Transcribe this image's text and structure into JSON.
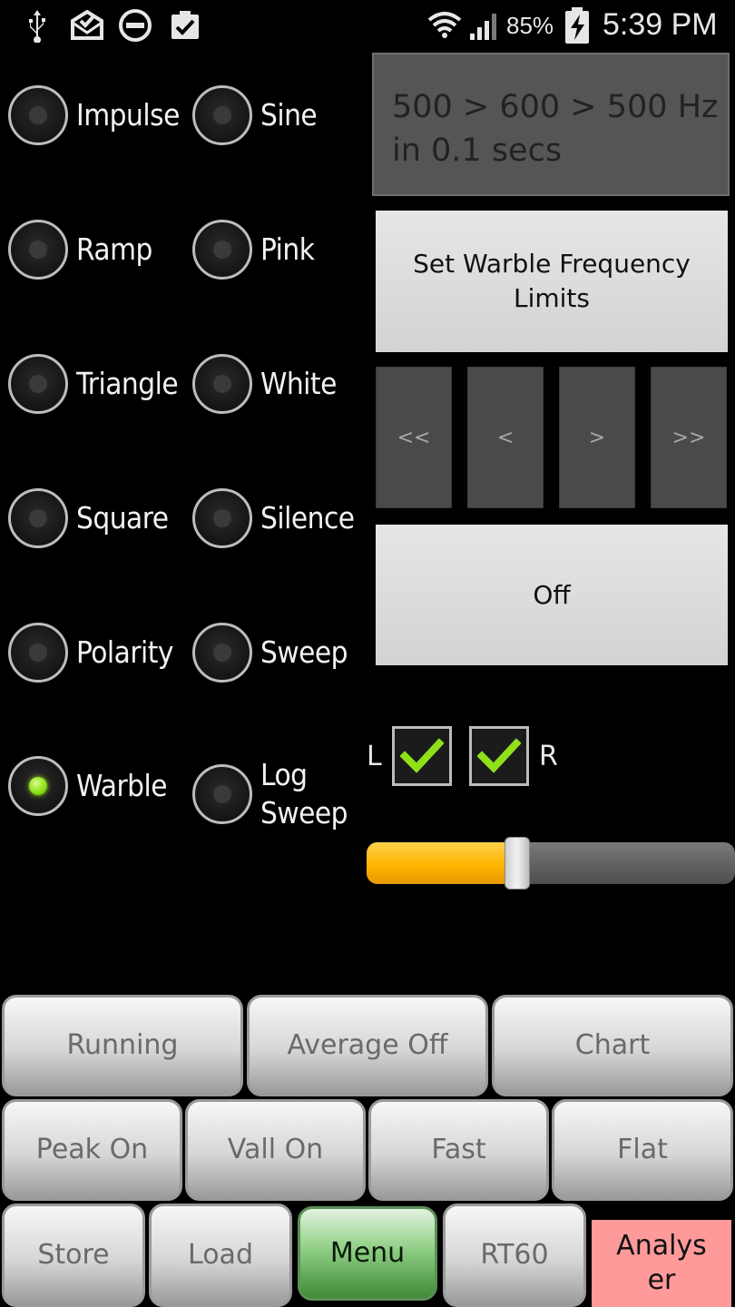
{
  "status_bar": {
    "battery_percent": "85%",
    "time": "5:39 PM",
    "icons": [
      "usb-icon",
      "mail-download-icon",
      "do-not-disturb-icon",
      "clipboard-check-icon",
      "wifi-icon",
      "signal-icon",
      "battery-charging-icon"
    ]
  },
  "signals": [
    {
      "label": "Impulse",
      "selected": false
    },
    {
      "label": "Sine",
      "selected": false
    },
    {
      "label": "Ramp",
      "selected": false
    },
    {
      "label": "Pink",
      "selected": false
    },
    {
      "label": "Triangle",
      "selected": false
    },
    {
      "label": "White",
      "selected": false
    },
    {
      "label": "Square",
      "selected": false
    },
    {
      "label": "Silence",
      "selected": false
    },
    {
      "label": "Polarity",
      "selected": false
    },
    {
      "label": "Sweep",
      "selected": false
    },
    {
      "label": "Warble",
      "selected": true
    },
    {
      "label": "Log Sweep",
      "selected": false
    }
  ],
  "frequency_display": {
    "line1": "500 > 600 > 500 Hz",
    "line2": "in 0.1 secs"
  },
  "set_warble_button": "Set Warble Frequency Limits",
  "nav_buttons": [
    "<<",
    "<",
    ">",
    ">>"
  ],
  "off_button": "Off",
  "channels": {
    "left_label": "L",
    "right_label": "R",
    "left_checked": true,
    "right_checked": true,
    "check_color": "#8fe019"
  },
  "volume_level_percent": 41,
  "bottom_buttons": {
    "row1": [
      "Running",
      "Average Off",
      "Chart"
    ],
    "row2": [
      "Peak On",
      "Vall On",
      "Fast",
      "Flat"
    ],
    "row3": [
      "Store",
      "Load",
      "Menu",
      "RT60",
      "Analys er"
    ]
  },
  "colors": {
    "accent_green": "#8fe019",
    "slider_fill": "#ffb300",
    "menu_green": "#3f8a36",
    "analyser_red": "#ff9a9a"
  }
}
